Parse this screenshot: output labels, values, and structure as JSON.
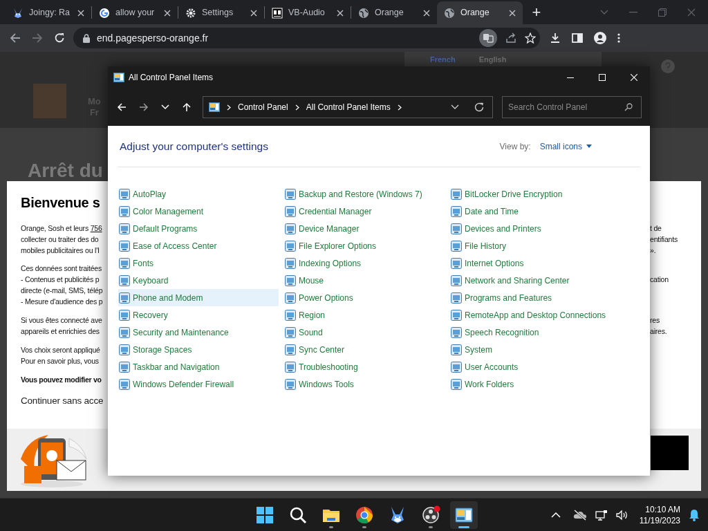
{
  "browser": {
    "tabs": [
      {
        "title": "Joingy: Ra",
        "selected": false
      },
      {
        "title": "allow your",
        "selected": false
      },
      {
        "title": "Settings",
        "selected": false
      },
      {
        "title": "VB-Audio",
        "selected": false
      },
      {
        "title": "Orange",
        "selected": false
      },
      {
        "title": "Orange",
        "selected": true
      }
    ],
    "new_tab": "+",
    "address": "end.pagesperso-orange.fr"
  },
  "translate_popup": {
    "languages": [
      {
        "label": "French",
        "selected": true
      },
      {
        "label": "English",
        "selected": false
      }
    ]
  },
  "background_page": {
    "header_texts": [
      "Mo",
      "Fr"
    ],
    "heading": "Arrêt du",
    "consent": {
      "title": "Bienvenue s",
      "intro_line": {
        "text": "Orange, Sosh et leurs",
        "link": "756",
        "right": "t de"
      },
      "paragraphs": [
        [
          {
            "left": "collecter ou traiter des do",
            "right": "entifiants"
          },
          {
            "left": "mobiles publicitaires ou l'I",
            "right": "»."
          }
        ],
        [
          {
            "left": "Ces données sont traitées"
          },
          {
            "left": "- Contenus et publicités p",
            "right": "cation"
          },
          {
            "left": "directe (e-mail, SMS, télép"
          },
          {
            "left": "- Mesure d'audience des p"
          }
        ],
        [
          {
            "left": "Si vous êtes connecté ave",
            "right": "res"
          },
          {
            "left": "appareils et enrichies des",
            "right": "aires."
          }
        ],
        [
          {
            "left": "Vos choix seront appliqué"
          },
          {
            "left": "Pour en savoir plus, vous"
          }
        ]
      ],
      "bold_note": "Vous pouvez modifier vo",
      "continue": "Continuer sans acce"
    }
  },
  "window": {
    "title": "All Control Panel Items",
    "breadcrumb": [
      "Control Panel",
      "All Control Panel Items"
    ],
    "search": {
      "placeholder": "Search Control Panel"
    },
    "heading": "Adjust your computer's settings",
    "view_by": {
      "label": "View by:",
      "value": "Small icons"
    },
    "columns": [
      [
        {
          "label": "AutoPlay",
          "hovered": false
        },
        {
          "label": "Color Management",
          "hovered": false
        },
        {
          "label": "Default Programs",
          "hovered": false
        },
        {
          "label": "Ease of Access Center",
          "hovered": false
        },
        {
          "label": "Fonts",
          "hovered": false
        },
        {
          "label": "Keyboard",
          "hovered": false
        },
        {
          "label": "Phone and Modem",
          "hovered": true
        },
        {
          "label": "Recovery",
          "hovered": false
        },
        {
          "label": "Security and Maintenance",
          "hovered": false
        },
        {
          "label": "Storage Spaces",
          "hovered": false
        },
        {
          "label": "Taskbar and Navigation",
          "hovered": false
        },
        {
          "label": "Windows Defender Firewall",
          "hovered": false
        }
      ],
      [
        {
          "label": "Backup and Restore (Windows 7)",
          "hovered": false
        },
        {
          "label": "Credential Manager",
          "hovered": false
        },
        {
          "label": "Device Manager",
          "hovered": false
        },
        {
          "label": "File Explorer Options",
          "hovered": false
        },
        {
          "label": "Indexing Options",
          "hovered": false
        },
        {
          "label": "Mouse",
          "hovered": false
        },
        {
          "label": "Power Options",
          "hovered": false
        },
        {
          "label": "Region",
          "hovered": false
        },
        {
          "label": "Sound",
          "hovered": false
        },
        {
          "label": "Sync Center",
          "hovered": false
        },
        {
          "label": "Troubleshooting",
          "hovered": false
        },
        {
          "label": "Windows Tools",
          "hovered": false
        }
      ],
      [
        {
          "label": "BitLocker Drive Encryption",
          "hovered": false
        },
        {
          "label": "Date and Time",
          "hovered": false
        },
        {
          "label": "Devices and Printers",
          "hovered": false
        },
        {
          "label": "File History",
          "hovered": false
        },
        {
          "label": "Internet Options",
          "hovered": false
        },
        {
          "label": "Network and Sharing Center",
          "hovered": false
        },
        {
          "label": "Programs and Features",
          "hovered": false
        },
        {
          "label": "RemoteApp and Desktop Connections",
          "hovered": false
        },
        {
          "label": "Speech Recognition",
          "hovered": false
        },
        {
          "label": "System",
          "hovered": false
        },
        {
          "label": "User Accounts",
          "hovered": false
        },
        {
          "label": "Work Folders",
          "hovered": false
        }
      ]
    ]
  },
  "taskbar": {
    "apps": [
      {
        "running": false,
        "active": false
      },
      {
        "running": false,
        "active": false
      },
      {
        "running": true,
        "active": false
      },
      {
        "running": true,
        "active": false
      },
      {
        "running": false,
        "active": false
      },
      {
        "running": true,
        "active": false
      },
      {
        "running": true,
        "active": true
      }
    ],
    "time": "10:10 AM",
    "date": "11/19/2023"
  }
}
